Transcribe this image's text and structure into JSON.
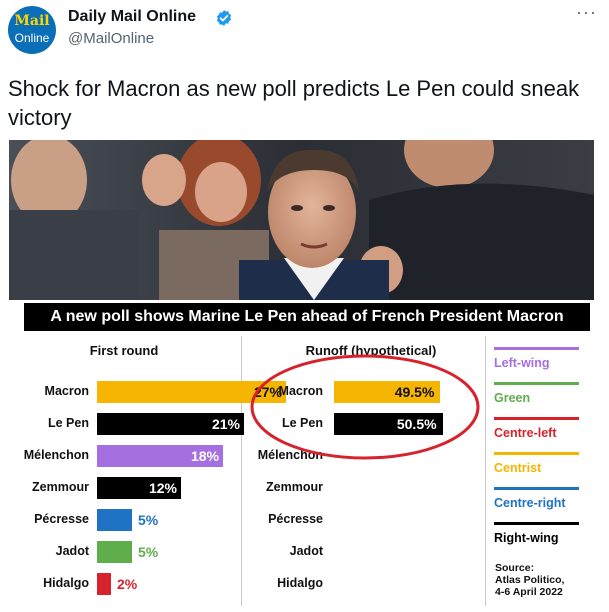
{
  "account": {
    "avatar_line1": "Mail",
    "avatar_line2": "Online",
    "name": "Daily Mail Online",
    "handle": "@MailOnline",
    "more": "···"
  },
  "tweet": {
    "text": "Shock for Macron as new poll predicts Le Pen could sneak victory"
  },
  "infographic": {
    "banner": "A new poll shows Marine Le Pen ahead of French President Macron",
    "colors": {
      "left_wing": "#a56fe0",
      "green": "#60ad4b",
      "centre_left": "#d7222c",
      "centrist": "#f5b500",
      "centre_right": "#1f73c4",
      "right_wing": "#000000"
    },
    "first_round": {
      "heading": "First round",
      "rows": [
        {
          "name": "Macron",
          "value": 27,
          "label": "27%",
          "color": "#f5b500",
          "text_color": "#111111"
        },
        {
          "name": "Le Pen",
          "value": 21,
          "label": "21%",
          "color": "#000000",
          "text_color": "#ffffff"
        },
        {
          "name": "Mélenchon",
          "value": 18,
          "label": "18%",
          "color": "#a56fe0",
          "text_color": "#ffffff"
        },
        {
          "name": "Zemmour",
          "value": 12,
          "label": "12%",
          "color": "#000000",
          "text_color": "#ffffff"
        },
        {
          "name": "Pécresse",
          "value": 5,
          "label": "5%",
          "color": "#1f73c4",
          "text_color": "#1f73c4"
        },
        {
          "name": "Jadot",
          "value": 5,
          "label": "5%",
          "color": "#60ad4b",
          "text_color": "#60ad4b"
        },
        {
          "name": "Hidalgo",
          "value": 2,
          "label": "2%",
          "color": "#d7222c",
          "text_color": "#d7222c"
        }
      ]
    },
    "runoff": {
      "heading": "Runoff (hypothetical)",
      "rows": [
        {
          "name": "Macron",
          "value": 49.5,
          "label": "49.5%",
          "color": "#f5b500",
          "text_color": "#111111"
        },
        {
          "name": "Le Pen",
          "value": 50.5,
          "label": "50.5%",
          "color": "#000000",
          "text_color": "#ffffff"
        },
        {
          "name": "Mélenchon"
        },
        {
          "name": "Zemmour"
        },
        {
          "name": "Pécresse"
        },
        {
          "name": "Jadot"
        },
        {
          "name": "Hidalgo"
        }
      ]
    },
    "legend": [
      {
        "label": "Left-wing",
        "color": "#a56fe0",
        "text_color": "#a56fe0"
      },
      {
        "label": "Green",
        "color": "#60ad4b",
        "text_color": "#60ad4b"
      },
      {
        "label": "Centre-left",
        "color": "#d7222c",
        "text_color": "#d7222c"
      },
      {
        "label": "Centrist",
        "color": "#f5b500",
        "text_color": "#f5b500"
      },
      {
        "label": "Centre-right",
        "color": "#1f73c4",
        "text_color": "#1f73c4"
      },
      {
        "label": "Right-wing",
        "color": "#000000",
        "text_color": "#000000"
      }
    ],
    "source": {
      "line1": "Source:",
      "line2": "Atlas Politico,",
      "line3": "4-6 April 2022"
    },
    "highlight_color": "#d7222c"
  },
  "chart_data": [
    {
      "type": "bar",
      "title": "First round",
      "categories": [
        "Macron",
        "Le Pen",
        "Mélenchon",
        "Zemmour",
        "Pécresse",
        "Jadot",
        "Hidalgo"
      ],
      "values": [
        27,
        21,
        18,
        12,
        5,
        5,
        2
      ]
    },
    {
      "type": "bar",
      "title": "Runoff (hypothetical)",
      "categories": [
        "Macron",
        "Le Pen"
      ],
      "values": [
        49.5,
        50.5
      ]
    }
  ]
}
